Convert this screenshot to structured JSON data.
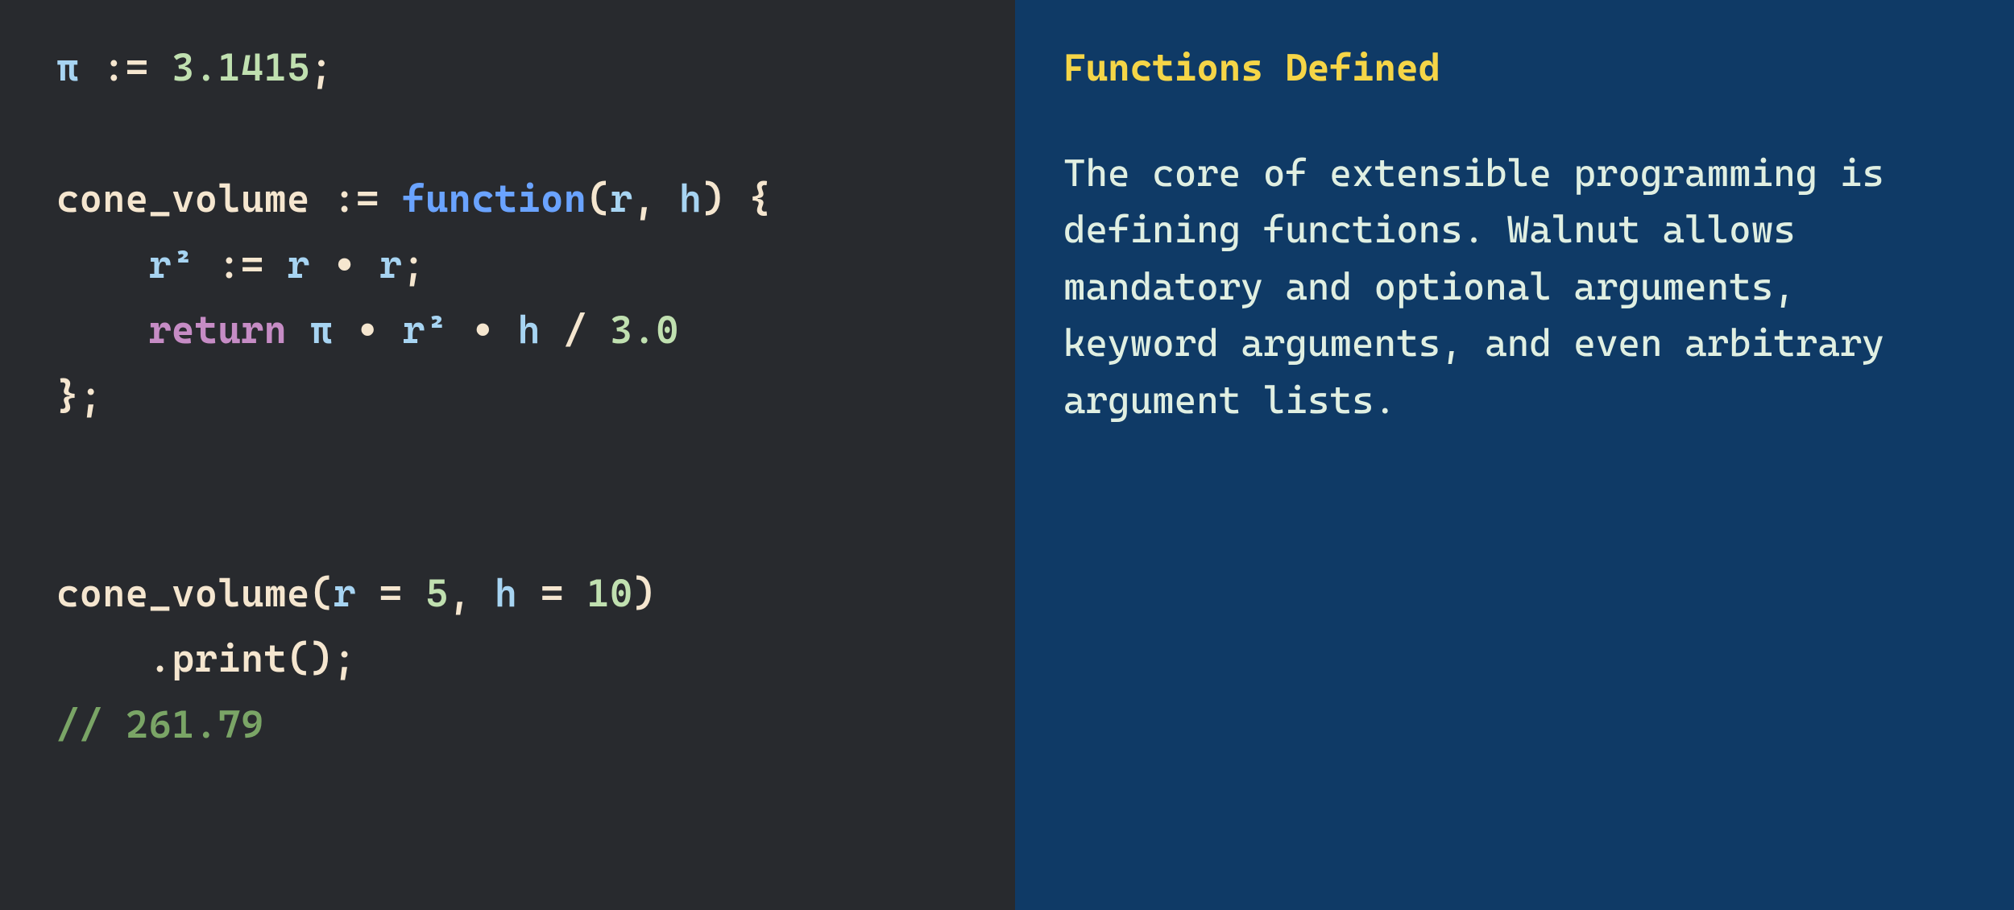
{
  "code": {
    "line1": {
      "t1": "π",
      "t2": " := ",
      "t3": "3.1415",
      "t4": ";"
    },
    "line2": {
      "t1": "cone_volume",
      "t2": " := ",
      "t3": "function",
      "t4": "(",
      "t5": "r",
      "t6": ", ",
      "t7": "h",
      "t8": ") {"
    },
    "line3": {
      "indent": "    ",
      "t1": "r²",
      "t2": " := ",
      "t3": "r",
      "t4": " • ",
      "t5": "r",
      "t6": ";"
    },
    "line4": {
      "indent": "    ",
      "t1": "return",
      "t2": " ",
      "t3": "π",
      "t4": " • ",
      "t5": "r²",
      "t6": " • ",
      "t7": "h",
      "t8": " / ",
      "t9": "3.0"
    },
    "line5": {
      "t1": "};"
    },
    "line6": {
      "t1": "cone_volume",
      "t2": "(",
      "t3": "r",
      "t4": " = ",
      "t5": "5",
      "t6": ", ",
      "t7": "h",
      "t8": " = ",
      "t9": "10",
      "t10": ")"
    },
    "line7": {
      "indent": "    ",
      "t1": ".print();"
    },
    "line8": {
      "t1": "// 261.79"
    }
  },
  "doc": {
    "title": "Functions Defined",
    "body": "The core of extensible programming is defining functions. Walnut allows mandatory and optional arguments, keyword arguments, and even arbitrary argument lists."
  }
}
